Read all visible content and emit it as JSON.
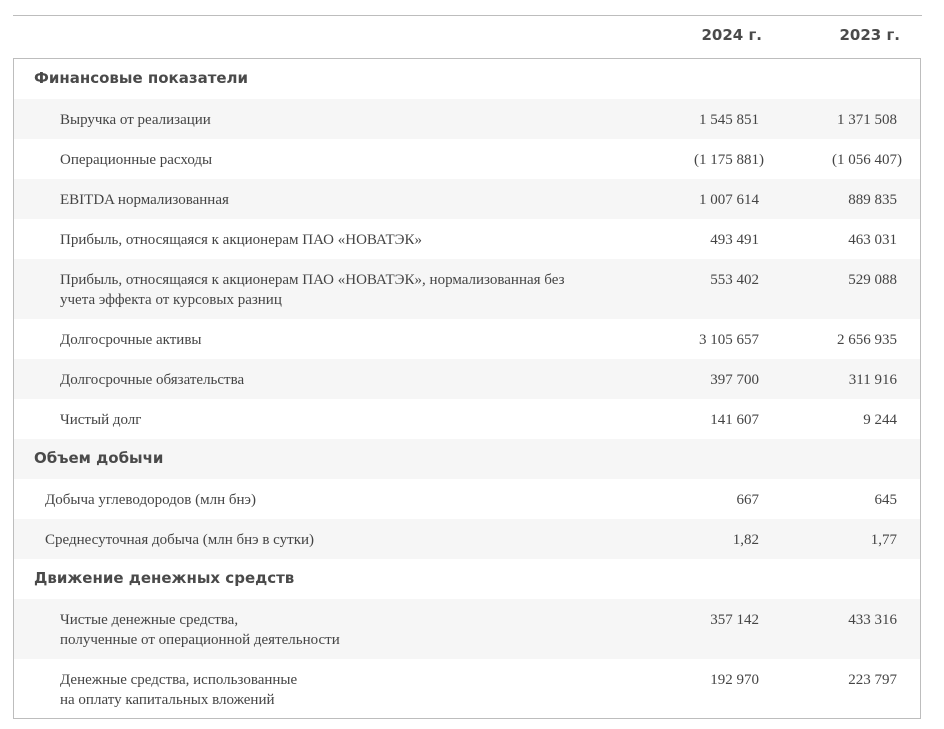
{
  "header": {
    "col_2024": "2024 г.",
    "col_2023": "2023 г."
  },
  "sections": {
    "financial": {
      "title": "Финансовые показатели",
      "rows": [
        {
          "label": "Выручка от реализации",
          "v2024": "1 545 851",
          "v2023": "1 371 508"
        },
        {
          "label": "Операционные расходы",
          "v2024": "(1 175 881)",
          "v2023": "(1 056 407)"
        },
        {
          "label": "EBITDA нормализованная",
          "v2024": "1 007 614",
          "v2023": "889 835"
        },
        {
          "label": "Прибыль, относящаяся к акционерам ПАО «НОВАТЭК»",
          "v2024": "493 491",
          "v2023": "463 031"
        },
        {
          "label_line1": "Прибыль, относящаяся к акционерам ПАО «НОВАТЭК», нормализованная без",
          "label_line2": "учета эффекта от курсовых разниц",
          "v2024": "553 402",
          "v2023": "529 088"
        },
        {
          "label": "Долгосрочные активы",
          "v2024": "3 105 657",
          "v2023": "2 656 935"
        },
        {
          "label": "Долгосрочные обязательства",
          "v2024": "397 700",
          "v2023": "311 916"
        },
        {
          "label": "Чистый долг",
          "v2024": "141 607",
          "v2023": "9 244"
        }
      ]
    },
    "production": {
      "title": "Объем добычи",
      "rows": [
        {
          "label": "Добыча углеводородов (млн бнэ)",
          "v2024": "667",
          "v2023": "645"
        },
        {
          "label": "Среднесуточная добыча (млн бнэ в сутки)",
          "v2024": "1,82",
          "v2023": "1,77"
        }
      ]
    },
    "cashflow": {
      "title": "Движение денежных средств",
      "rows": [
        {
          "label_line1": "Чистые денежные средства,",
          "label_line2": "полученные от операционной деятельности",
          "v2024": "357 142",
          "v2023": "433 316"
        },
        {
          "label_line1": "Денежные средства, использованные",
          "label_line2": "на оплату капитальных вложений",
          "v2024": "192 970",
          "v2023": "223 797"
        }
      ]
    }
  }
}
